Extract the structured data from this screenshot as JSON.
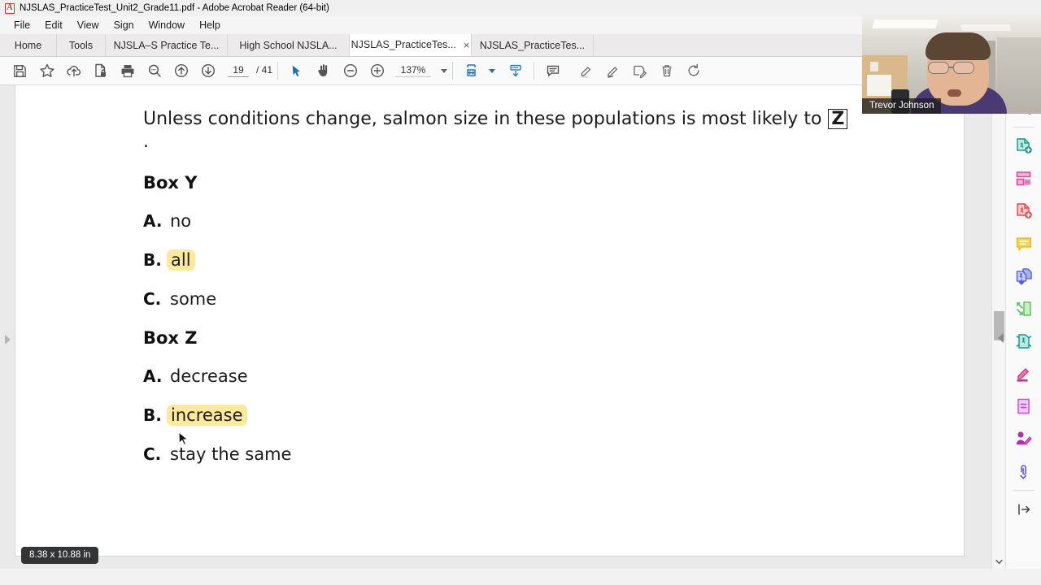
{
  "window": {
    "title": "NJSLAS_PracticeTest_Unit2_Grade11.pdf - Adobe Acrobat Reader (64-bit)",
    "app_icon": "acrobat-icon"
  },
  "menu": {
    "items": [
      {
        "label": "File"
      },
      {
        "label": "Edit"
      },
      {
        "label": "View"
      },
      {
        "label": "Sign"
      },
      {
        "label": "Window"
      },
      {
        "label": "Help"
      }
    ]
  },
  "tabs": {
    "home_label": "Home",
    "tools_label": "Tools",
    "documents": [
      {
        "label": "NJSLA–S Practice Te...",
        "active": false
      },
      {
        "label": "High School NJSLA...",
        "active": false
      },
      {
        "label": "NJSLAS_PracticeTes...",
        "active": true
      },
      {
        "label": "NJSLAS_PracticeTes...",
        "active": false
      }
    ],
    "close_glyph": "×"
  },
  "toolbar": {
    "left_icons": [
      {
        "name": "save-icon"
      },
      {
        "name": "star-icon"
      },
      {
        "name": "upload-cloud-icon"
      },
      {
        "name": "protect-document-icon"
      },
      {
        "name": "print-icon"
      },
      {
        "name": "search-icon"
      },
      {
        "name": "previous-page-icon"
      },
      {
        "name": "next-page-icon"
      }
    ],
    "page_current": "19",
    "page_total": "/ 41",
    "tool_icons": [
      {
        "name": "select-cursor-icon"
      },
      {
        "name": "hand-tool-icon"
      },
      {
        "name": "zoom-out-icon"
      },
      {
        "name": "zoom-in-icon"
      }
    ],
    "zoom_value": "137%",
    "right_icons": [
      {
        "name": "fit-page-icon"
      },
      {
        "name": "scroll-mode-icon"
      },
      {
        "name": "comment-icon"
      },
      {
        "name": "highlighter-icon"
      },
      {
        "name": "pen-icon"
      },
      {
        "name": "sign-icon"
      },
      {
        "name": "delete-icon"
      },
      {
        "name": "rotate-icon"
      }
    ]
  },
  "document": {
    "paragraph_prefix": "Unless conditions change, salmon size in these populations is most likely to ",
    "paragraph_box": "Z",
    "paragraph_suffix": ".",
    "box_y_heading": "Box Y",
    "box_y_options": [
      {
        "letter": "A.",
        "text": "no",
        "highlighted": false
      },
      {
        "letter": "B.",
        "text": "all",
        "highlighted": true
      },
      {
        "letter": "C.",
        "text": "some",
        "highlighted": false
      }
    ],
    "box_z_heading": "Box Z",
    "box_z_options": [
      {
        "letter": "A.",
        "text": "decrease",
        "highlighted": false
      },
      {
        "letter": "B.",
        "text": "increase",
        "highlighted": true
      },
      {
        "letter": "C.",
        "text": "stay the same",
        "highlighted": false
      }
    ],
    "highlight_color": "#fde99a",
    "page_dimensions": "8.38 x 10.88 in"
  },
  "rail": {
    "icons": [
      {
        "name": "search-pdf-icon",
        "color": "#4a4a4a"
      },
      {
        "name": "create-pdf-icon",
        "color": "#0f9b8e"
      },
      {
        "name": "combine-files-icon",
        "color": "#e0439b"
      },
      {
        "name": "export-pdf-icon",
        "color": "#e8454a"
      },
      {
        "name": "comment-tool-icon",
        "color": "#f0c020"
      },
      {
        "name": "organize-pages-icon",
        "color": "#4b5bd4"
      },
      {
        "name": "compress-pdf-icon",
        "color": "#5bbd5b"
      },
      {
        "name": "protect-pdf-icon",
        "color": "#0f9b8e"
      },
      {
        "name": "fill-and-sign-icon",
        "color": "#d12d7a"
      },
      {
        "name": "edit-pdf-icon",
        "color": "#c050d8"
      },
      {
        "name": "request-signature-icon",
        "color": "#b42fb0"
      },
      {
        "name": "more-tools-icon",
        "color": "#6a5bd4"
      },
      {
        "name": "collapse-panel-icon",
        "color": "#4a4a4a"
      }
    ]
  },
  "webcam": {
    "participant_name": "Trevor Johnson"
  }
}
